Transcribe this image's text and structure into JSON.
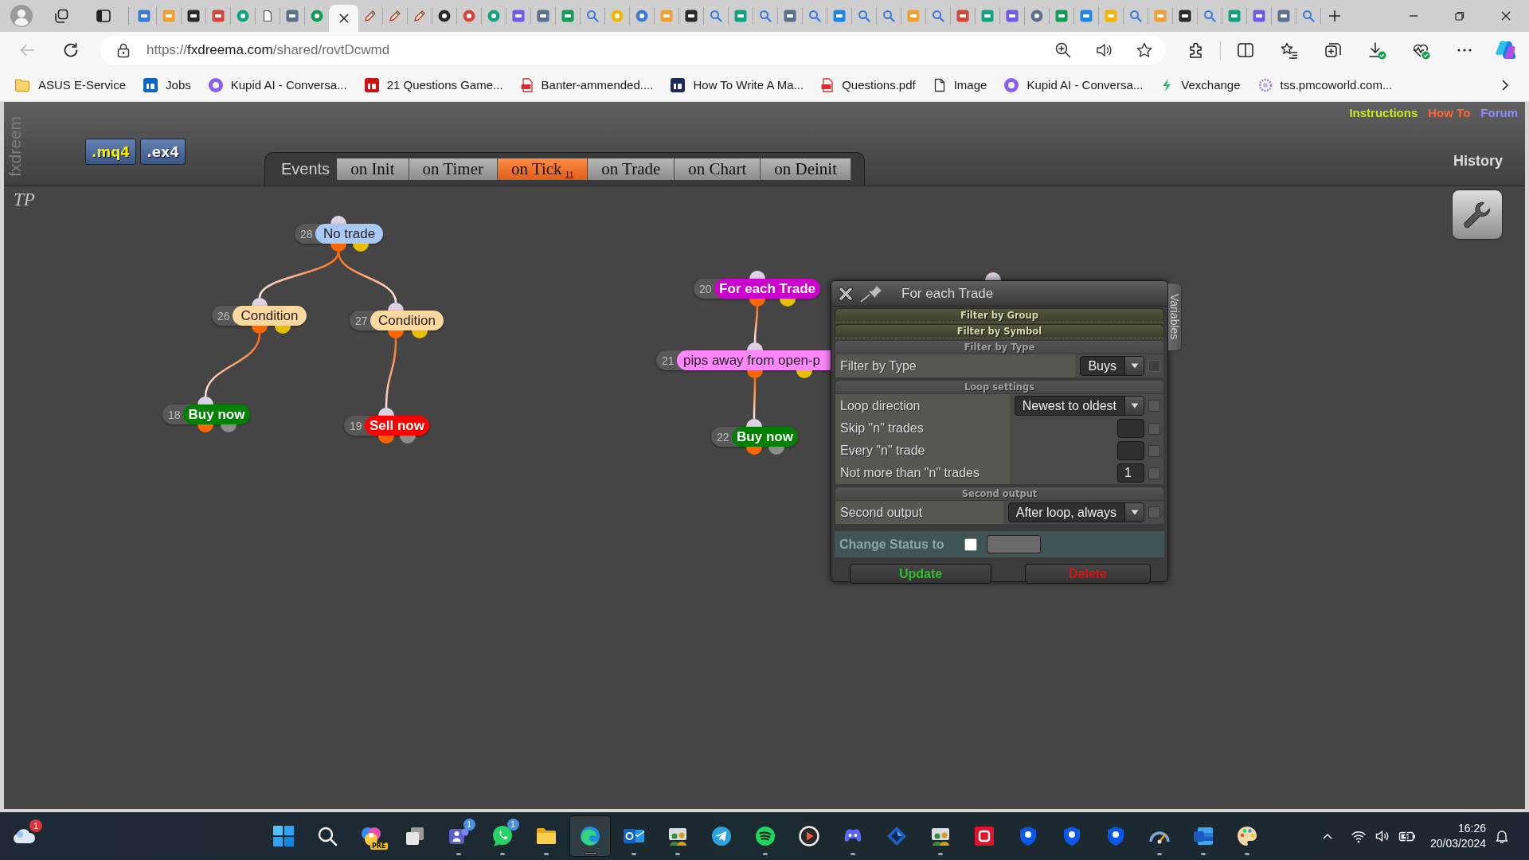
{
  "browser": {
    "tabs": [
      {
        "selected": false
      },
      {
        "selected": false
      },
      {
        "selected": false
      },
      {
        "selected": false
      },
      {
        "selected": false
      },
      {
        "selected": false
      },
      {
        "selected": false
      },
      {
        "selected": false
      },
      {
        "selected": true
      },
      {
        "selected": false
      },
      {
        "selected": false
      },
      {
        "selected": false
      },
      {
        "selected": false
      },
      {
        "selected": false
      },
      {
        "selected": false
      },
      {
        "selected": false
      },
      {
        "selected": false
      },
      {
        "selected": false
      },
      {
        "selected": false
      },
      {
        "selected": false
      },
      {
        "selected": false
      },
      {
        "selected": false
      },
      {
        "selected": false
      },
      {
        "selected": false
      },
      {
        "selected": false
      },
      {
        "selected": false
      },
      {
        "selected": false
      },
      {
        "selected": false
      },
      {
        "selected": false
      },
      {
        "selected": false
      },
      {
        "selected": false
      },
      {
        "selected": false
      },
      {
        "selected": false
      },
      {
        "selected": false
      },
      {
        "selected": false
      },
      {
        "selected": false
      },
      {
        "selected": false
      },
      {
        "selected": false
      },
      {
        "selected": false
      },
      {
        "selected": false
      },
      {
        "selected": false
      },
      {
        "selected": false
      },
      {
        "selected": false
      },
      {
        "selected": false
      },
      {
        "selected": false
      },
      {
        "selected": false
      },
      {
        "selected": false
      },
      {
        "selected": false
      }
    ],
    "back_disabled": true,
    "address": {
      "scheme": "https://",
      "host": "fxdreema.com",
      "path": "/shared/rovtDcwmd"
    },
    "bookmarks": [
      {
        "label": "ASUS E-Service"
      },
      {
        "label": "Jobs"
      },
      {
        "label": "Kupid AI - Conversa..."
      },
      {
        "label": "21 Questions Game..."
      },
      {
        "label": "Banter-ammended...."
      },
      {
        "label": "How To Write A Ma..."
      },
      {
        "label": "Questions.pdf"
      },
      {
        "label": "Image"
      },
      {
        "label": "Kupid AI - Conversa..."
      },
      {
        "label": "Vexchange"
      },
      {
        "label": "tss.pmcoworld.com..."
      }
    ]
  },
  "app": {
    "logo": "fxdreem",
    "file_buttons": [
      {
        "label": ".mq4",
        "selected": true
      },
      {
        "label": ".ex4",
        "selected": false
      }
    ],
    "events_label": "Events",
    "event_tabs": [
      {
        "label": "on Init",
        "selected": false
      },
      {
        "label": "on Timer",
        "selected": false
      },
      {
        "label": "on Tick",
        "count": "11",
        "selected": true
      },
      {
        "label": "on Trade",
        "selected": false
      },
      {
        "label": "on Chart",
        "selected": false
      },
      {
        "label": "on Deinit",
        "selected": false
      }
    ],
    "links": [
      {
        "label": "Instructions",
        "color": "#c8e61e"
      },
      {
        "label": "How To",
        "color": "#ff6633"
      },
      {
        "label": "Forum",
        "color": "#8c8cff"
      }
    ],
    "history": "History",
    "canvas_label": "TP",
    "nodes": [
      {
        "number": "28",
        "label": "No trade",
        "color": "#a8c8f8",
        "outputs": [
          {
            "color": "#ff6600"
          },
          {
            "color": "#e6c000"
          }
        ],
        "children": [
          {
            "number": "26",
            "label": "Condition",
            "color": "#ffd8a0",
            "outputs": [
              {
                "color": "#ff6600"
              },
              {
                "color": "#e6c000"
              }
            ],
            "children": [
              {
                "number": "18",
                "label": "Buy now",
                "color": "#008000",
                "outputs": [
                  {
                    "color": "#ff6600"
                  },
                  {
                    "color": "#8c8c8c"
                  }
                ]
              }
            ]
          },
          {
            "number": "27",
            "label": "Condition",
            "color": "#ffd8a0",
            "outputs": [
              {
                "color": "#ff6600"
              },
              {
                "color": "#e6c000"
              }
            ],
            "children": [
              {
                "number": "19",
                "label": "Sell now",
                "color": "#ff0000",
                "outputs": [
                  {
                    "color": "#ff6600"
                  },
                  {
                    "color": "#8c8c8c"
                  }
                ]
              }
            ]
          }
        ]
      },
      {
        "number": "20",
        "label": "For each Trade",
        "color": "#cc00cc",
        "outputs": [
          {
            "color": "#ff6600"
          },
          {
            "color": "#e6c000"
          }
        ],
        "children": [
          {
            "number": "21",
            "label": "pips away from open-p",
            "color": "#ff88ff",
            "outputs": [
              {
                "color": "#ff6600"
              },
              {
                "color": "#e6c000"
              }
            ],
            "children": [
              {
                "number": "22",
                "label": "Buy now",
                "color": "#008000",
                "outputs": [
                  {
                    "color": "#ff6600"
                  },
                  {
                    "color": "#8c8c8c"
                  }
                ]
              }
            ]
          }
        ]
      }
    ],
    "dialog": {
      "title": "For each Trade",
      "sections": [
        {
          "title": "Filter by Group",
          "expanded": false
        },
        {
          "title": "Filter by Symbol",
          "expanded": false
        },
        {
          "title": "Filter by Type",
          "expanded": true,
          "rows": [
            {
              "label": "Filter by Type",
              "kind": "select",
              "value": "Buys",
              "checked": false,
              "disabled": true
            }
          ]
        },
        {
          "title": "Loop settings",
          "expanded": true,
          "rows": [
            {
              "label": "Loop direction",
              "kind": "select",
              "value": "Newest to oldest",
              "checked": false,
              "disabled": false
            },
            {
              "label": "Skip \"n\" trades",
              "kind": "number",
              "checked": false,
              "disabled": false
            },
            {
              "label": "Every \"n\" trade",
              "kind": "number",
              "checked": false,
              "disabled": false
            },
            {
              "label": "Not more than \"n\" trades",
              "kind": "number",
              "value": "1",
              "checked": false,
              "disabled": false
            }
          ]
        },
        {
          "title": "Second output",
          "expanded": true,
          "rows": [
            {
              "label": "Second output",
              "kind": "select",
              "value": "After loop, always",
              "checked": false,
              "disabled": false
            }
          ]
        }
      ],
      "status": {
        "label": "Change Status to",
        "checked": false
      },
      "buttons": [
        {
          "label": "Update",
          "kind": "update"
        },
        {
          "label": "Delete",
          "kind": "delete"
        }
      ],
      "side_tab": "Variables"
    }
  },
  "taskbar": {
    "weather_badge": "1",
    "apps": [
      {
        "running": false,
        "selected": false
      },
      {
        "running": false,
        "selected": false
      },
      {
        "running": false,
        "selected": false,
        "tag": "PRE"
      },
      {
        "running": false,
        "selected": false
      },
      {
        "running": true,
        "selected": false,
        "badge": "1"
      },
      {
        "running": true,
        "selected": false,
        "badge": "1"
      },
      {
        "running": true,
        "selected": false
      },
      {
        "running": true,
        "selected": true
      },
      {
        "running": true,
        "selected": false
      },
      {
        "running": true,
        "selected": false
      },
      {
        "running": false,
        "selected": false
      },
      {
        "running": true,
        "selected": false
      },
      {
        "running": false,
        "selected": false
      },
      {
        "running": true,
        "selected": false
      },
      {
        "running": false,
        "selected": false
      },
      {
        "running": true,
        "selected": false
      },
      {
        "running": false,
        "selected": false
      },
      {
        "running": false,
        "selected": false
      },
      {
        "running": false,
        "selected": false
      },
      {
        "running": false,
        "selected": false
      },
      {
        "running": true,
        "selected": false
      },
      {
        "running": true,
        "selected": false
      },
      {
        "running": true,
        "selected": false
      }
    ],
    "time": "16:26",
    "date": "20/03/2024"
  }
}
